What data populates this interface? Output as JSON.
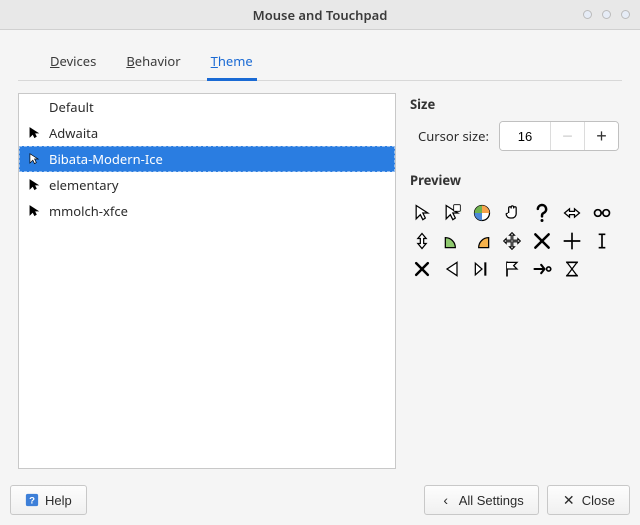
{
  "window": {
    "title": "Mouse and Touchpad"
  },
  "tabs": {
    "devices": "Devices",
    "behavior": "Behavior",
    "theme": "Theme",
    "active": "theme"
  },
  "themes": {
    "items": [
      {
        "name": "Default",
        "selected": false,
        "has_icon": false
      },
      {
        "name": "Adwaita",
        "selected": false,
        "has_icon": true
      },
      {
        "name": "Bibata-Modern-Ice",
        "selected": true,
        "has_icon": true
      },
      {
        "name": "elementary",
        "selected": false,
        "has_icon": true
      },
      {
        "name": "mmolch-xfce",
        "selected": false,
        "has_icon": true
      }
    ]
  },
  "size": {
    "section_title": "Size",
    "label": "Cursor size:",
    "value": "16"
  },
  "preview": {
    "section_title": "Preview"
  },
  "footer": {
    "help": "Help",
    "all_settings": "All Settings",
    "close": "Close"
  }
}
